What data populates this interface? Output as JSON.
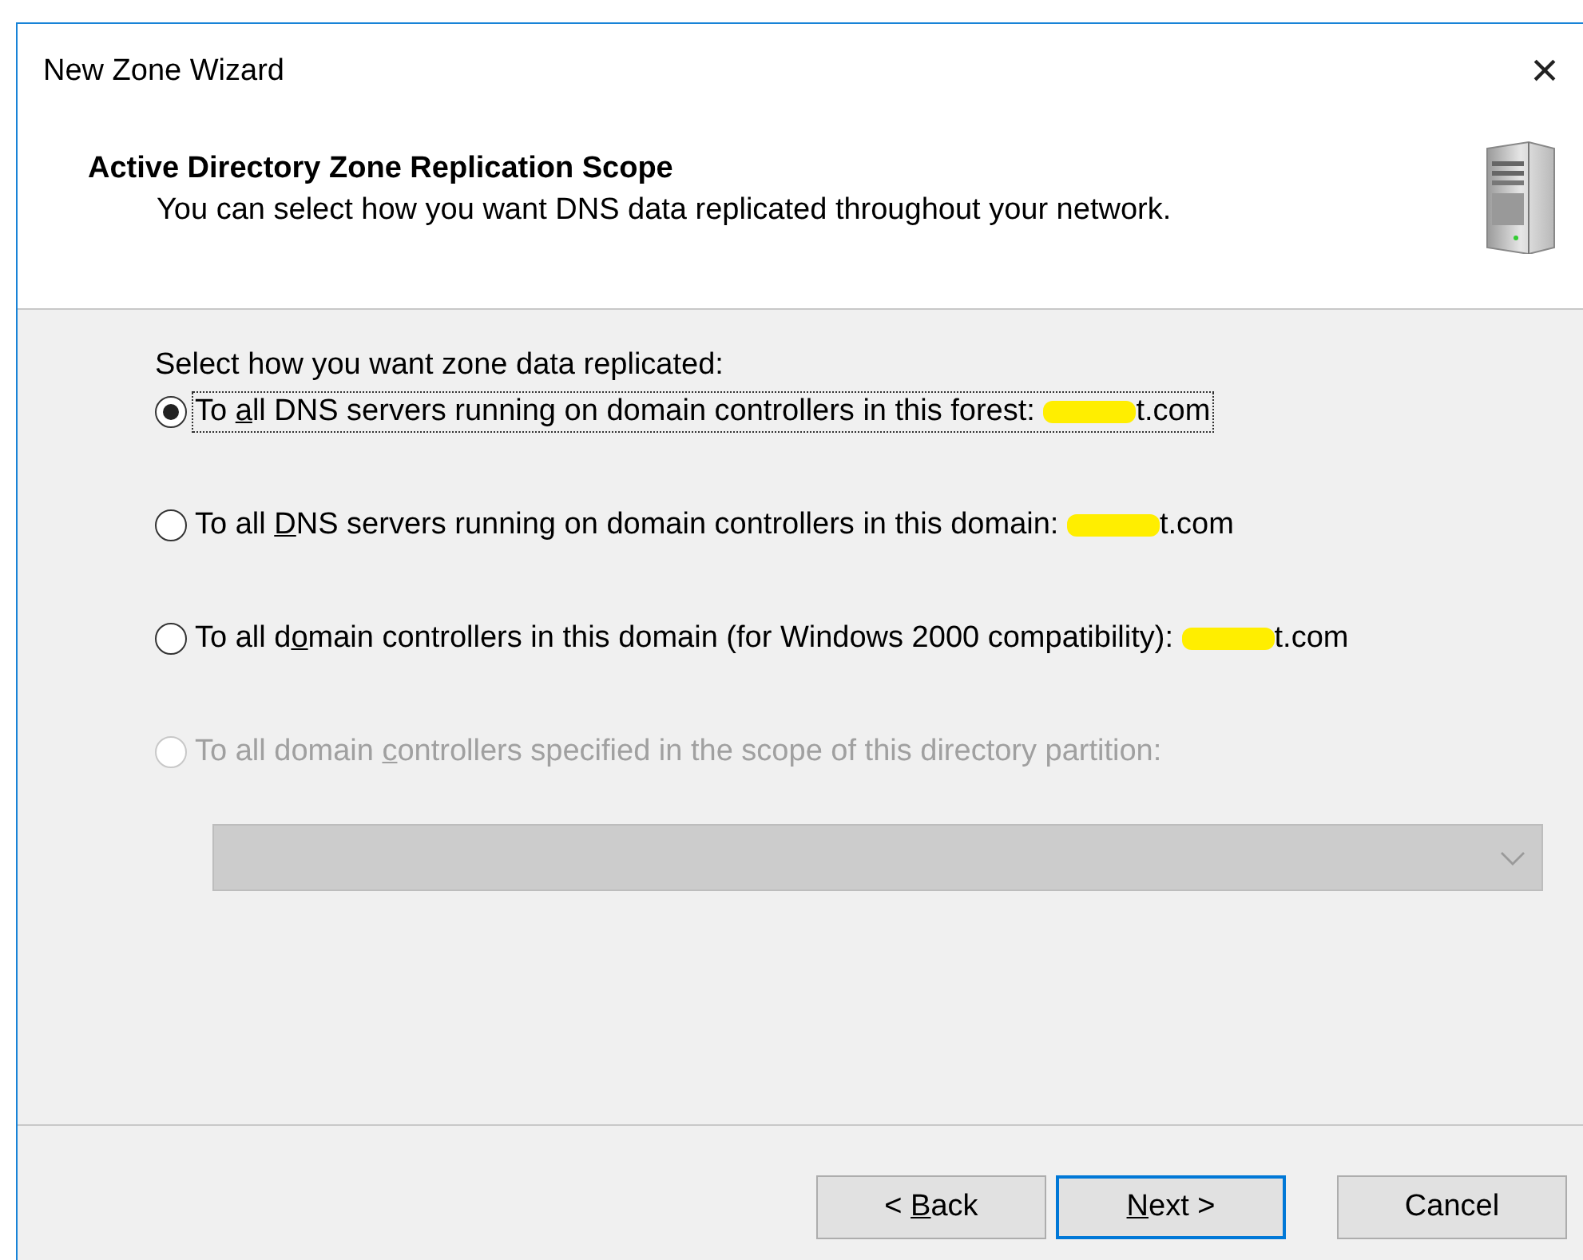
{
  "window": {
    "title": "New Zone Wizard",
    "close": "×"
  },
  "header": {
    "title": "Active Directory Zone Replication Scope",
    "subtitle": "You can select how you want DNS data replicated throughout your network."
  },
  "prompt": "Select how you want zone data replicated:",
  "options": [
    {
      "pre": "To ",
      "key": "a",
      "post": "ll DNS servers running on domain controllers in this forest: ",
      "domain": "t.com",
      "redacted": true,
      "selected": true,
      "disabled": false,
      "focused": true
    },
    {
      "pre": "To all ",
      "key": "D",
      "post": "NS servers running on domain controllers in this domain: ",
      "domain": "t.com",
      "redacted": true,
      "selected": false,
      "disabled": false,
      "focused": false
    },
    {
      "pre": "To all d",
      "key": "o",
      "post": "main controllers in this domain (for Windows 2000 compatibility): ",
      "domain": "t.com",
      "redacted": true,
      "selected": false,
      "disabled": false,
      "focused": false
    },
    {
      "pre": "To all domain ",
      "key": "c",
      "post": "ontrollers specified in the scope of this directory partition:",
      "selected": false,
      "disabled": true,
      "focused": false
    }
  ],
  "partition_dropdown": {
    "disabled": true
  },
  "buttons": [
    {
      "pre": "< ",
      "key": "B",
      "post": "ack",
      "default": false
    },
    {
      "key": "N",
      "post": "ext >",
      "default": true
    },
    {
      "pre": "Cancel",
      "default": false
    }
  ]
}
